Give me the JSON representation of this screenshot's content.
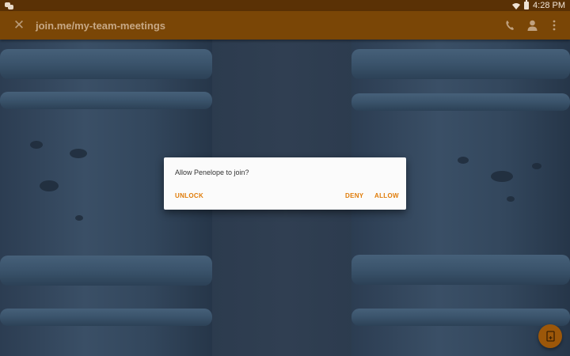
{
  "status_bar": {
    "time": "4:28 PM",
    "left_icon": "chat-bubbles-icon",
    "icons": [
      "wifi-icon",
      "battery-icon"
    ]
  },
  "toolbar": {
    "close_icon": "close-icon",
    "url": "join.me/my-team-meetings",
    "actions": [
      "phone-icon",
      "person-icon",
      "more-vert-icon"
    ]
  },
  "dialog": {
    "message": "Allow Penelope to join?",
    "unlock_label": "UNLOCK",
    "deny_label": "DENY",
    "allow_label": "ALLOW"
  },
  "fab": {
    "icon": "document-icon"
  },
  "colors": {
    "status_bar": "#5a3105",
    "toolbar": "#7a4606",
    "accent": "#e07c09",
    "dialog_bg": "#fbfbfb",
    "fab": "#9c5709"
  }
}
